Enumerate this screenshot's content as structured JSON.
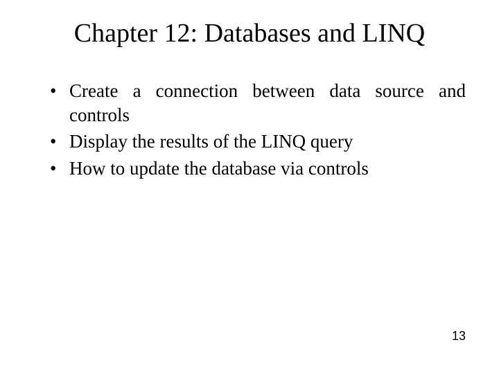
{
  "title": "Chapter 12: Databases and LINQ",
  "bullets": [
    "Create a connection between data source and controls",
    "Display the results of the LINQ query",
    "How to update the database via controls"
  ],
  "pageNumber": "13"
}
